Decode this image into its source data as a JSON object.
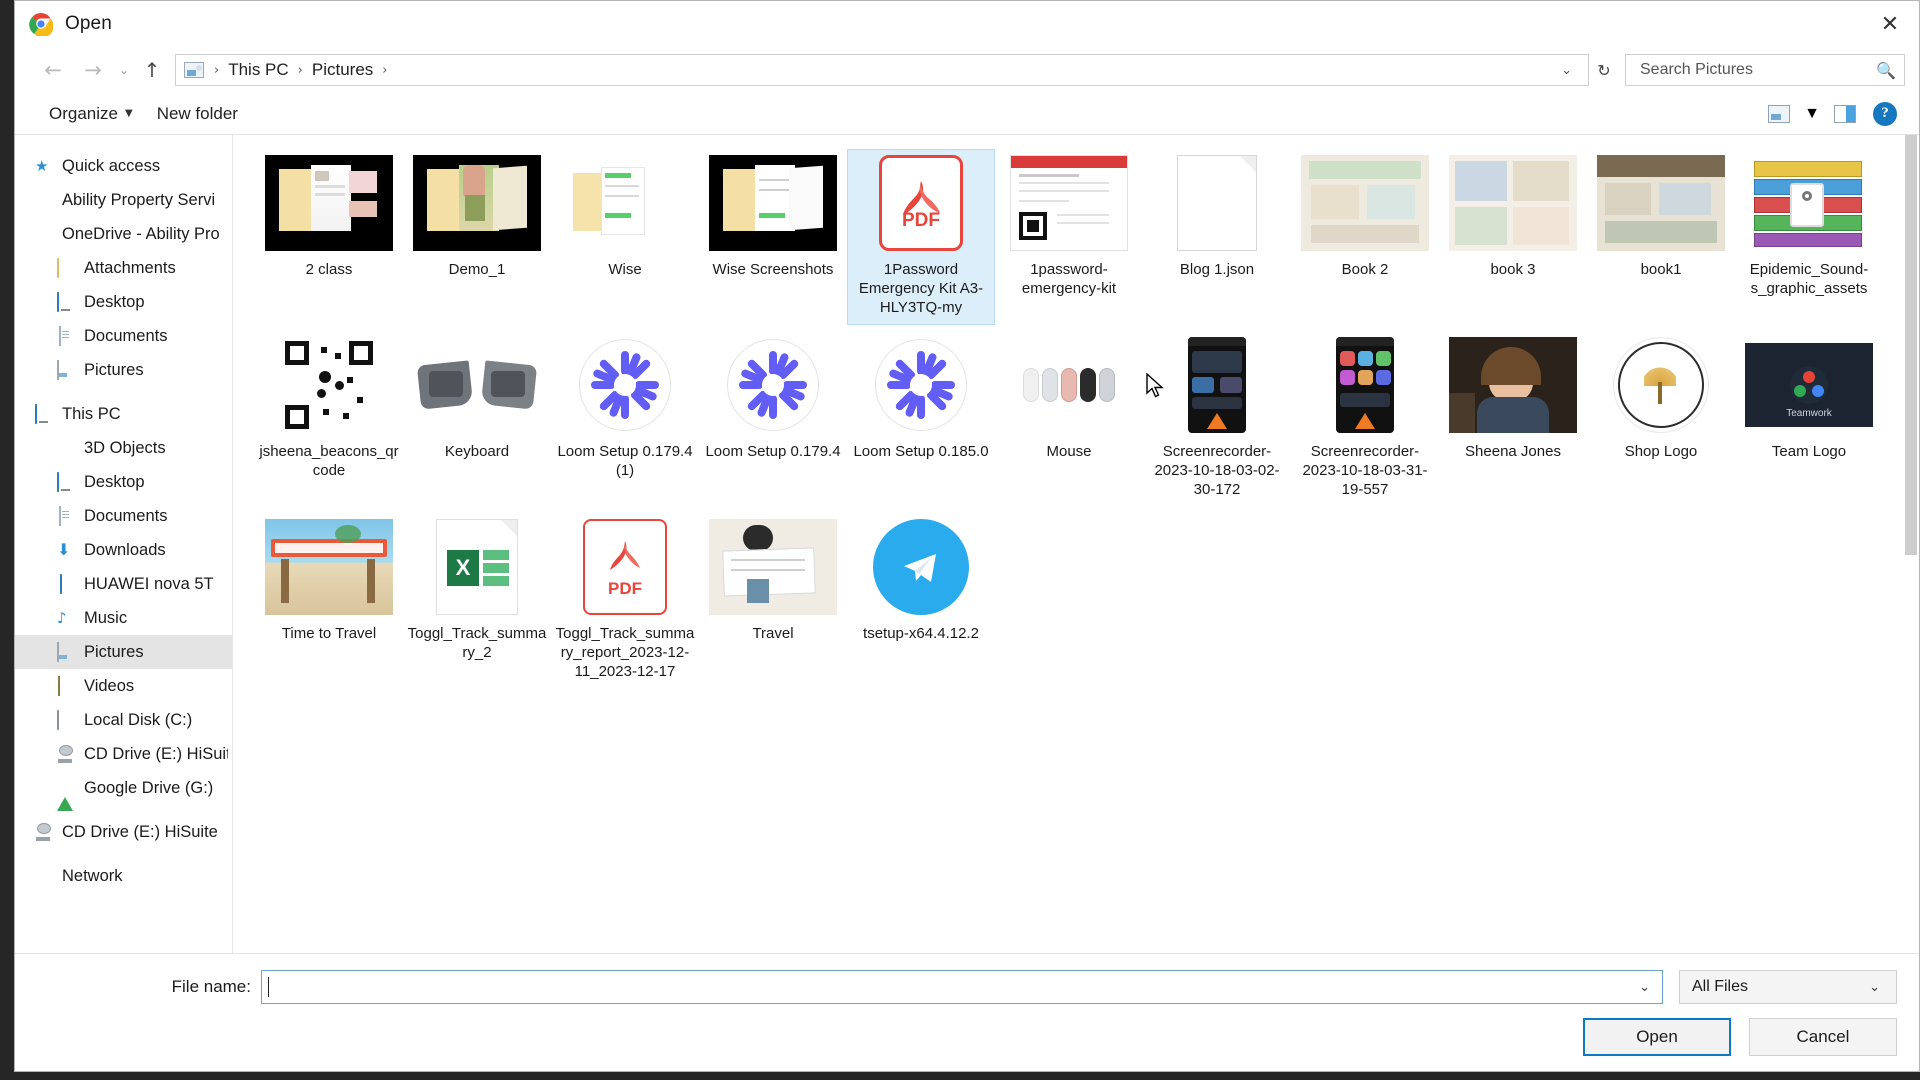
{
  "window": {
    "title": "Open",
    "app_icon": "chrome-logo-icon",
    "close_label": "✕"
  },
  "nav": {
    "back": "←",
    "forward": "→",
    "recent": "⌄",
    "up": "↑",
    "refresh": "↻",
    "dropdown": "⌄",
    "breadcrumbs": [
      "This PC",
      "Pictures"
    ],
    "separator": "›"
  },
  "search": {
    "placeholder": "Search Pictures",
    "value": "",
    "icon": "search-icon"
  },
  "commandbar": {
    "organize": "Organize",
    "organize_caret": "▼",
    "new_folder": "New folder",
    "view_icon": "view-layout-icon",
    "view_caret": "▼",
    "pane_icon": "preview-pane-icon",
    "help_icon": "help-icon",
    "help_glyph": "?"
  },
  "sidebar": {
    "items": [
      {
        "label": "Quick access",
        "icon": "star-icon",
        "level": 0,
        "selected": false
      },
      {
        "label": "Ability Property Servi",
        "icon": "building-icon",
        "level": 0,
        "selected": false
      },
      {
        "label": "OneDrive - Ability Pro",
        "icon": "cloud-icon",
        "level": 0,
        "selected": false
      },
      {
        "label": "Attachments",
        "icon": "folder-icon",
        "level": 1,
        "selected": false
      },
      {
        "label": "Desktop",
        "icon": "monitor-icon",
        "level": 1,
        "selected": false
      },
      {
        "label": "Documents",
        "icon": "document-icon",
        "level": 1,
        "selected": false
      },
      {
        "label": "Pictures",
        "icon": "pictures-icon",
        "level": 1,
        "selected": false
      },
      {
        "label": "This PC",
        "icon": "monitor-icon",
        "level": 0,
        "selected": false
      },
      {
        "label": "3D Objects",
        "icon": "3d-objects-icon",
        "level": 1,
        "selected": false
      },
      {
        "label": "Desktop",
        "icon": "monitor-icon",
        "level": 1,
        "selected": false
      },
      {
        "label": "Documents",
        "icon": "document-icon",
        "level": 1,
        "selected": false
      },
      {
        "label": "Downloads",
        "icon": "download-icon",
        "level": 1,
        "selected": false
      },
      {
        "label": "HUAWEI nova 5T",
        "icon": "phone-icon",
        "level": 1,
        "selected": false
      },
      {
        "label": "Music",
        "icon": "music-note-icon",
        "level": 1,
        "selected": false
      },
      {
        "label": "Pictures",
        "icon": "pictures-icon",
        "level": 1,
        "selected": true
      },
      {
        "label": "Videos",
        "icon": "video-icon",
        "level": 1,
        "selected": false
      },
      {
        "label": "Local Disk (C:)",
        "icon": "disk-icon",
        "level": 1,
        "selected": false
      },
      {
        "label": "CD Drive (E:) HiSuit",
        "icon": "cd-drive-icon",
        "level": 1,
        "selected": false
      },
      {
        "label": "Google Drive (G:)",
        "icon": "google-drive-icon",
        "level": 1,
        "selected": false
      },
      {
        "label": "CD Drive (E:) HiSuite",
        "icon": "cd-drive-icon",
        "level": 0,
        "selected": false
      },
      {
        "label": "Network",
        "icon": "network-icon",
        "level": 0,
        "selected": false
      }
    ]
  },
  "files": [
    {
      "label": "2 class",
      "thumb": "black-folder",
      "selected": false
    },
    {
      "label": "Demo_1",
      "thumb": "black-folder-photo",
      "selected": false
    },
    {
      "label": "Wise",
      "thumb": "white-folder",
      "selected": false
    },
    {
      "label": "Wise Screenshots",
      "thumb": "black-folder-doc",
      "selected": false
    },
    {
      "label": "1Password Emergency Kit A3-HLY3TQ-my",
      "thumb": "pdf-acrobat",
      "selected": true
    },
    {
      "label": "1password-emergency-kit",
      "thumb": "emergency-kit-doc",
      "selected": false
    },
    {
      "label": "Blog 1.json",
      "thumb": "blank-document",
      "selected": false
    },
    {
      "label": "Book 2",
      "thumb": "book-photo",
      "selected": false
    },
    {
      "label": "book 3",
      "thumb": "book-photo-2",
      "selected": false
    },
    {
      "label": "book1",
      "thumb": "book-photo-3",
      "selected": false
    },
    {
      "label": "Epidemic_Sound-s_graphic_assets",
      "thumb": "winrar-archive",
      "selected": false
    },
    {
      "label": "jsheena_beacons_qrcode",
      "thumb": "qr-code",
      "selected": false
    },
    {
      "label": "Keyboard",
      "thumb": "keyboard-photo",
      "selected": false
    },
    {
      "label": "Loom Setup 0.179.4 (1)",
      "thumb": "loom-installer",
      "selected": false
    },
    {
      "label": "Loom Setup 0.179.4",
      "thumb": "loom-installer",
      "selected": false
    },
    {
      "label": "Loom Setup 0.185.0",
      "thumb": "loom-installer",
      "selected": false
    },
    {
      "label": "Mouse",
      "thumb": "mouse-photo",
      "selected": false
    },
    {
      "label": "Screenrecorder-2023-10-18-03-02-30-172",
      "thumb": "phone-screenshot",
      "selected": false
    },
    {
      "label": "Screenrecorder-2023-10-18-03-31-19-557",
      "thumb": "phone-screenshot-2",
      "selected": false
    },
    {
      "label": "Sheena Jones",
      "thumb": "portrait-photo",
      "selected": false
    },
    {
      "label": "Shop Logo",
      "thumb": "circle-logo",
      "selected": false
    },
    {
      "label": "Team Logo",
      "thumb": "team-logo",
      "selected": false
    },
    {
      "label": "Time to Travel",
      "thumb": "travel-photo",
      "selected": false
    },
    {
      "label": "Toggl_Track_summary_2",
      "thumb": "excel-file",
      "selected": false
    },
    {
      "label": "Toggl_Track_summary_report_2023-12-11_2023-12-17",
      "thumb": "pdf-file",
      "selected": false
    },
    {
      "label": "Travel",
      "thumb": "map-photo",
      "selected": false
    },
    {
      "label": "tsetup-x64.4.12.2",
      "thumb": "telegram-installer",
      "selected": false
    }
  ],
  "footer": {
    "filename_label": "File name:",
    "filename_value": "",
    "filename_chevron": "⌄",
    "filetype_value": "All Files",
    "filetype_chevron": "⌄",
    "open_button": "Open",
    "cancel_button": "Cancel"
  },
  "colors": {
    "selection_fill": "#ddeefb",
    "selection_border": "#b9dcf4",
    "primary_button_border": "#0d7ac4",
    "accent_blue": "#1679c0",
    "pdf_red": "#e8453c",
    "sidebar_selected": "#e4e4e4"
  }
}
